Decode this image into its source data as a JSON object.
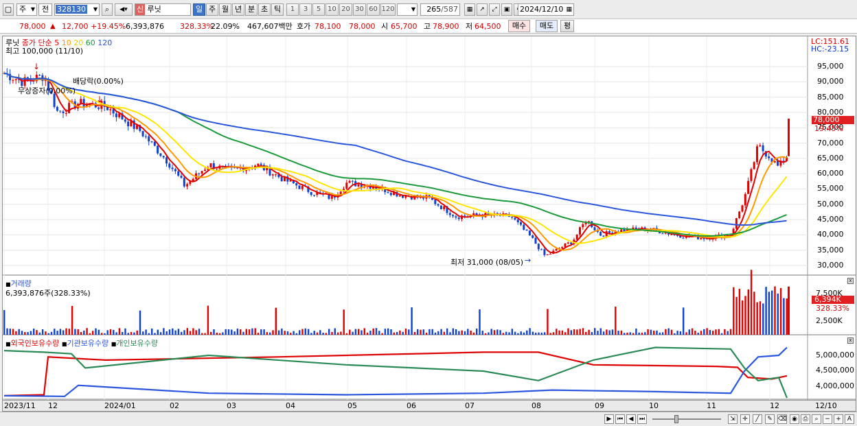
{
  "toolbar": {
    "type_label": "주",
    "market_label": "전",
    "code": "328130",
    "sign": "신",
    "name": "루닛",
    "periods": [
      "일",
      "주",
      "월",
      "년",
      "분",
      "초",
      "틱"
    ],
    "minutes": [
      "1",
      "3",
      "5",
      "10",
      "20",
      "30",
      "60",
      "120"
    ],
    "count": "265",
    "total": "/587",
    "date": "2024/12/10"
  },
  "quote": {
    "price": "78,000",
    "change": "12,700",
    "change_pct": "+19.45%",
    "volume": "6,393,876",
    "vol_ratio": "328.33%",
    "turnover": "22.09%",
    "amount": "467,607백만",
    "bid_label": "호가",
    "bid": "78,100",
    "ask": "78,000",
    "open_label": "시",
    "open": "65,700",
    "high_label": "고",
    "high": "78,900",
    "low_label": "저",
    "low": "64,500",
    "buy_label": "매수",
    "sell_label": "매도",
    "avg_label": "평"
  },
  "price_panel": {
    "legend_name": "루닛",
    "legend_ma": "종가 단순",
    "ma_periods": [
      "5",
      "10",
      "20",
      "60",
      "120"
    ],
    "ma_colors": [
      "#e00000",
      "#ff9900",
      "#ffe600",
      "#1a9a3a",
      "#2a55dd"
    ],
    "note_high": "최고 100,000 (11/10)",
    "note_rights": "무상증자(0.00%)",
    "note_div": "배당락(0.00%)",
    "note_low": "최저 31,000 (08/05)",
    "lc": "LC:151.61",
    "hc": "HC:-23.15",
    "y_ticks": [
      "95,000",
      "90,000",
      "85,000",
      "80,000",
      "75,000",
      "70,000",
      "65,000",
      "60,000",
      "55,000",
      "50,000",
      "45,000",
      "40,000",
      "35,000",
      "30,000"
    ],
    "last_price": "78,000",
    "last_pct": "19.45%"
  },
  "volume_panel": {
    "title": "거래량",
    "value": "6,393,876주(328.33%)",
    "y_ticks": [
      "7,500K",
      "2,500K"
    ],
    "last": "6,394K",
    "last_pct": "328.33%"
  },
  "holding_panel": {
    "series": [
      "외국인보유수량",
      "기관보유수량",
      "개인보유수량"
    ],
    "series_colors": [
      "#dd0000",
      "#2a55dd",
      "#2a8a55"
    ],
    "y_ticks": [
      "5,000,000",
      "4,500,000",
      "4,000,000"
    ]
  },
  "x_axis": [
    "2023/11",
    "12",
    "2024/01",
    "02",
    "03",
    "04",
    "05",
    "06",
    "07",
    "08",
    "09",
    "10",
    "11",
    "12",
    "12/10"
  ]
}
